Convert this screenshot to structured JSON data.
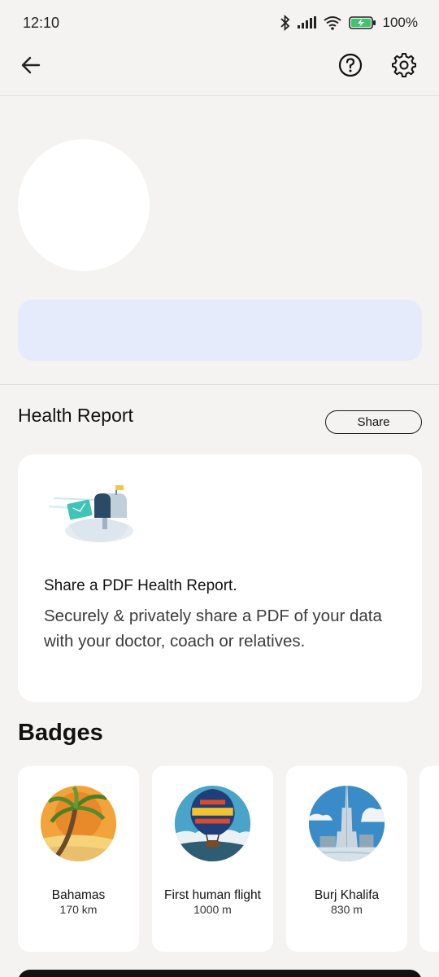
{
  "status_bar": {
    "time": "12:10",
    "battery": "100%",
    "icons": [
      "bluetooth-icon",
      "signal-icon",
      "wifi-icon",
      "battery-icon"
    ]
  },
  "toolbar": {
    "back_icon": "arrow-left-icon",
    "help_icon": "question-circle-icon",
    "settings_icon": "gear-icon"
  },
  "health_report": {
    "title": "Health Report",
    "share_label": "Share",
    "card_heading": "Share a PDF Health Report.",
    "card_text": "Securely & privately share a PDF of your data with your doctor, coach or relatives."
  },
  "badges": {
    "title": "Badges",
    "items": [
      {
        "name": "Bahamas",
        "value": "170 km"
      },
      {
        "name": "First human flight",
        "value": "1000 m"
      },
      {
        "name": "Burj Khalifa",
        "value": "830 m"
      }
    ]
  },
  "colors": {
    "background": "#f4f3f1",
    "banner": "#e6ebfb",
    "card": "#ffffff",
    "text": "#111111"
  }
}
